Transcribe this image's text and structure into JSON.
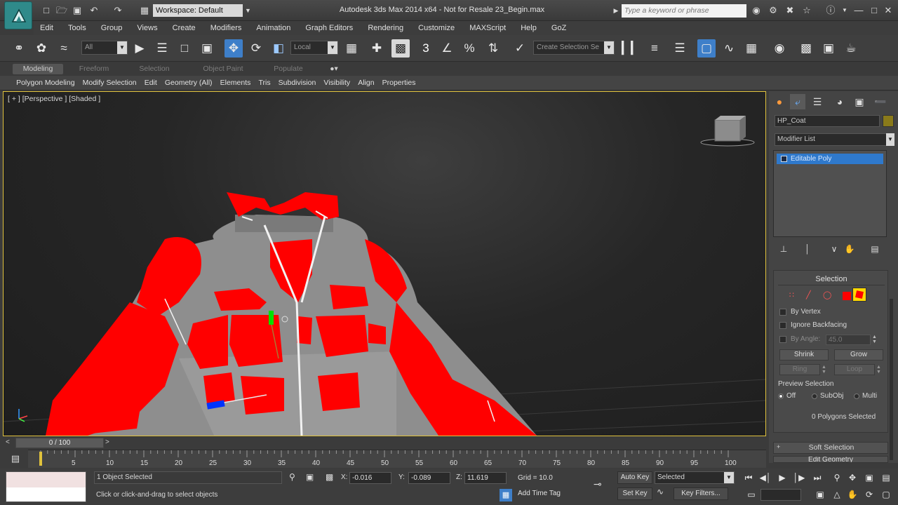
{
  "titlebar": {
    "workspace": "Workspace: Default",
    "title": "Autodesk 3ds Max  2014 x64  - Not for Resale   23_Begin.max",
    "search_placeholder": "Type a keyword or phrase"
  },
  "menu": [
    "Edit",
    "Tools",
    "Group",
    "Views",
    "Create",
    "Modifiers",
    "Animation",
    "Graph Editors",
    "Rendering",
    "Customize",
    "MAXScript",
    "Help",
    "GoZ"
  ],
  "toolbar": {
    "selection_filter": "All",
    "coord_system": "Local",
    "named_selection": "Create Selection Se",
    "snap_label": "3"
  },
  "ribbon": {
    "tabs": [
      "Modeling",
      "Freeform",
      "Selection",
      "Object Paint",
      "Populate"
    ],
    "panels": [
      "Polygon Modeling",
      "Modify Selection",
      "Edit",
      "Geometry (All)",
      "Elements",
      "Tris",
      "Subdivision",
      "Visibility",
      "Align",
      "Properties"
    ]
  },
  "viewport": {
    "label": "[ + ] [Perspective ] [Shaded ]"
  },
  "command_panel": {
    "object_name": "HP_Coat",
    "modifier_list": "Modifier List",
    "stack_item": "Editable Poly",
    "selection": {
      "title": "Selection",
      "by_vertex": "By Vertex",
      "ignore_backfacing": "Ignore Backfacing",
      "by_angle": "By Angle:",
      "by_angle_value": "45.0",
      "shrink": "Shrink",
      "grow": "Grow",
      "ring": "Ring",
      "loop": "Loop",
      "preview_title": "Preview Selection",
      "preview_off": "Off",
      "preview_subobj": "SubObj",
      "preview_multi": "Multi",
      "status": "0 Polygons Selected"
    },
    "soft_selection": "Soft Selection",
    "edit_geometry": "Edit Geometry"
  },
  "timeline": {
    "slider": "0 / 100",
    "ticks": [
      "5",
      "10",
      "15",
      "20",
      "25",
      "30",
      "35",
      "40",
      "45",
      "50",
      "55",
      "60",
      "65",
      "70",
      "75",
      "80",
      "85",
      "90",
      "95",
      "100"
    ]
  },
  "status": {
    "selection": "1 Object Selected",
    "prompt": "Click or click-and-drag to select objects",
    "x_label": "X:",
    "x": "-0.016",
    "y_label": "Y:",
    "y": "-0.089",
    "z_label": "Z:",
    "z": "11.619",
    "grid": "Grid = 10.0",
    "add_time_tag": "Add Time Tag",
    "auto_key": "Auto Key",
    "set_key": "Set Key",
    "selected": "Selected",
    "key_filters": "Key Filters..."
  },
  "colors": {
    "selection_red": "#ff0000",
    "accent_blue": "#3e7fc9",
    "viewport_border": "#e0c23c"
  }
}
